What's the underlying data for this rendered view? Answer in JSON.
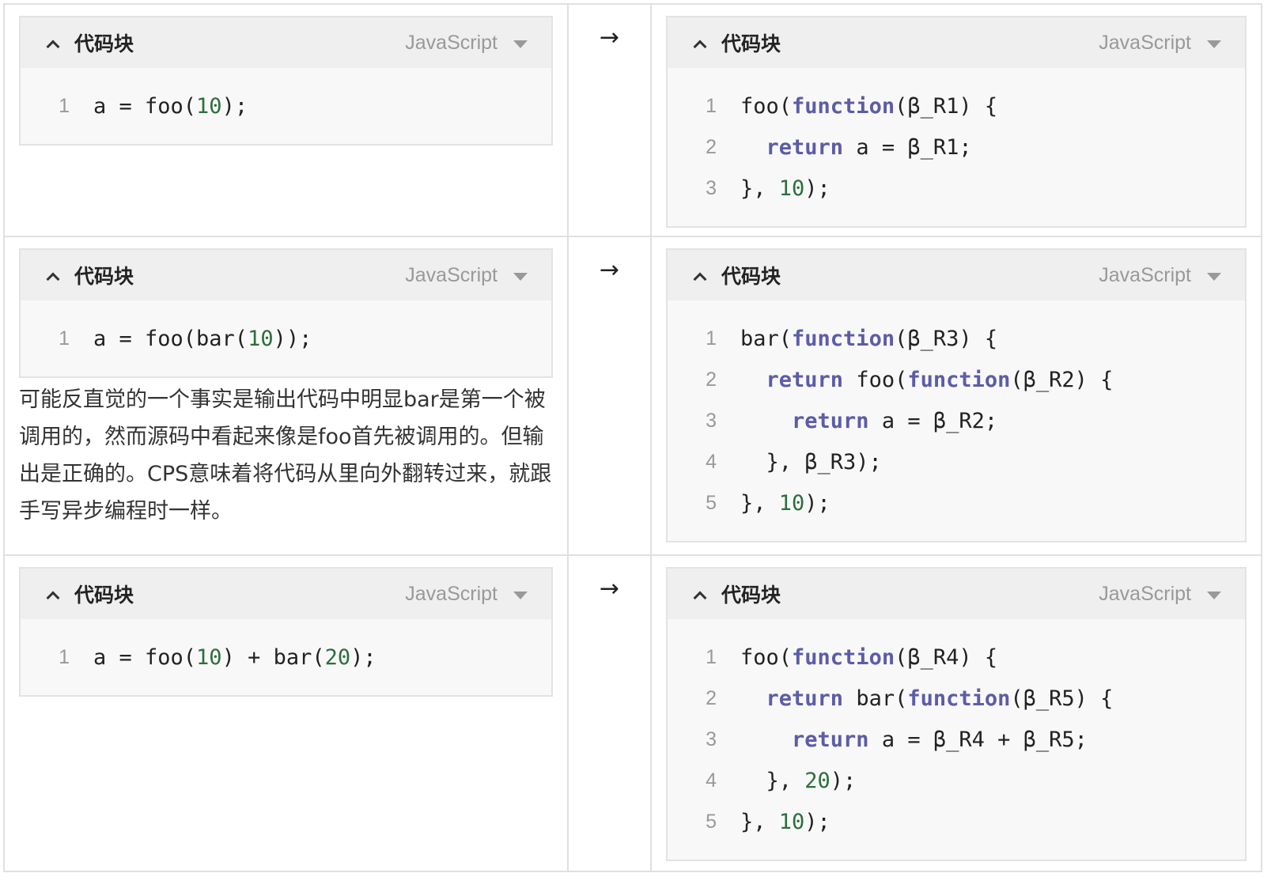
{
  "block_title": "代码块",
  "language": "JavaScript",
  "arrow": "→",
  "rows": [
    {
      "left": [
        {
          "n": "1",
          "tokens": [
            {
              "t": "a = foo(",
              "k": ""
            },
            {
              "t": "10",
              "k": "num"
            },
            {
              "t": ");",
              "k": ""
            }
          ]
        }
      ],
      "right": [
        {
          "n": "1",
          "tokens": [
            {
              "t": "foo(",
              "k": ""
            },
            {
              "t": "function",
              "k": "kw"
            },
            {
              "t": "(β_R1) {",
              "k": ""
            }
          ]
        },
        {
          "n": "2",
          "tokens": [
            {
              "t": "  ",
              "k": ""
            },
            {
              "t": "return",
              "k": "kw"
            },
            {
              "t": " a = β_R1;",
              "k": ""
            }
          ]
        },
        {
          "n": "3",
          "tokens": [
            {
              "t": "}, ",
              "k": ""
            },
            {
              "t": "10",
              "k": "num"
            },
            {
              "t": ");",
              "k": ""
            }
          ]
        }
      ]
    },
    {
      "left": [
        {
          "n": "1",
          "tokens": [
            {
              "t": "a = foo(bar(",
              "k": ""
            },
            {
              "t": "10",
              "k": "num"
            },
            {
              "t": "));",
              "k": ""
            }
          ]
        }
      ],
      "note": "可能反直觉的一个事实是输出代码中明显bar是第一个被调用的，然而源码中看起来像是foo首先被调用的。但输出是正确的。CPS意味着将代码从里向外翻转过来，就跟手写异步编程时一样。",
      "right": [
        {
          "n": "1",
          "tokens": [
            {
              "t": "bar(",
              "k": ""
            },
            {
              "t": "function",
              "k": "kw"
            },
            {
              "t": "(β_R3) {",
              "k": ""
            }
          ]
        },
        {
          "n": "2",
          "tokens": [
            {
              "t": "  ",
              "k": ""
            },
            {
              "t": "return",
              "k": "kw"
            },
            {
              "t": " foo(",
              "k": ""
            },
            {
              "t": "function",
              "k": "kw"
            },
            {
              "t": "(β_R2) {",
              "k": ""
            }
          ]
        },
        {
          "n": "3",
          "tokens": [
            {
              "t": "    ",
              "k": ""
            },
            {
              "t": "return",
              "k": "kw"
            },
            {
              "t": " a = β_R2;",
              "k": ""
            }
          ]
        },
        {
          "n": "4",
          "tokens": [
            {
              "t": "  }, β_R3);",
              "k": ""
            }
          ]
        },
        {
          "n": "5",
          "tokens": [
            {
              "t": "}, ",
              "k": ""
            },
            {
              "t": "10",
              "k": "num"
            },
            {
              "t": ");",
              "k": ""
            }
          ]
        }
      ]
    },
    {
      "left": [
        {
          "n": "1",
          "tokens": [
            {
              "t": "a = foo(",
              "k": ""
            },
            {
              "t": "10",
              "k": "num"
            },
            {
              "t": ") + bar(",
              "k": ""
            },
            {
              "t": "20",
              "k": "num"
            },
            {
              "t": ");",
              "k": ""
            }
          ]
        }
      ],
      "right": [
        {
          "n": "1",
          "tokens": [
            {
              "t": "foo(",
              "k": ""
            },
            {
              "t": "function",
              "k": "kw"
            },
            {
              "t": "(β_R4) {",
              "k": ""
            }
          ]
        },
        {
          "n": "2",
          "tokens": [
            {
              "t": "  ",
              "k": ""
            },
            {
              "t": "return",
              "k": "kw"
            },
            {
              "t": " bar(",
              "k": ""
            },
            {
              "t": "function",
              "k": "kw"
            },
            {
              "t": "(β_R5) {",
              "k": ""
            }
          ]
        },
        {
          "n": "3",
          "tokens": [
            {
              "t": "    ",
              "k": ""
            },
            {
              "t": "return",
              "k": "kw"
            },
            {
              "t": " a = β_R4 + β_R5;",
              "k": ""
            }
          ]
        },
        {
          "n": "4",
          "tokens": [
            {
              "t": "  }, ",
              "k": ""
            },
            {
              "t": "20",
              "k": "num"
            },
            {
              "t": ");",
              "k": ""
            }
          ]
        },
        {
          "n": "5",
          "tokens": [
            {
              "t": "}, ",
              "k": ""
            },
            {
              "t": "10",
              "k": "num"
            },
            {
              "t": ");",
              "k": ""
            }
          ]
        }
      ]
    }
  ]
}
